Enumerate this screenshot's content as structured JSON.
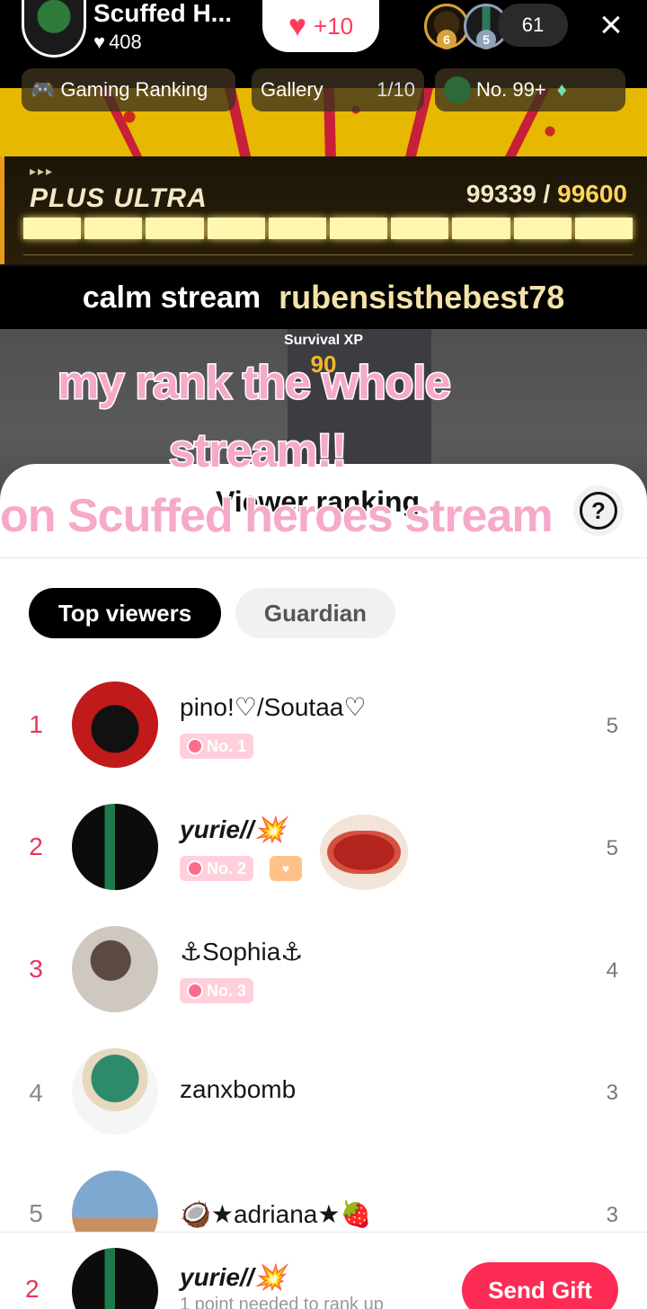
{
  "header": {
    "host_name": "Scuffed H...",
    "likes": "408",
    "like_pill": "+10",
    "viewer_badges": [
      "6",
      "5"
    ],
    "viewer_count": "61",
    "close_icon": "×"
  },
  "chips": {
    "gaming_ranking": "Gaming Ranking",
    "gallery": "Gallery",
    "gallery_count": "1/10",
    "rank": "No. 99+"
  },
  "goal": {
    "dots": "▸▸▸",
    "title": "PLUS ULTRA",
    "current": "99339",
    "separator": " / ",
    "target": "99600",
    "segments": 10
  },
  "banner": {
    "label": "calm stream",
    "user": "rubensisthebest78"
  },
  "survival": {
    "label": "Survival XP",
    "value": "90"
  },
  "caption": {
    "line1": "my rank the whole",
    "line2": "stream!!",
    "line3": "on Scuffed heroes stream"
  },
  "sheet": {
    "title": "Viewer ranking",
    "help": "?",
    "tabs": [
      "Top viewers",
      "Guardian"
    ]
  },
  "rows": [
    {
      "rank": "1",
      "name": "pino!♡/Soutaa♡",
      "badge": "No. 1",
      "score": "5"
    },
    {
      "rank": "2",
      "name": "yurie//💥",
      "badge": "No. 2",
      "score": "5"
    },
    {
      "rank": "3",
      "name": "⚓Sophia⚓",
      "badge": "No. 3",
      "score": "4"
    },
    {
      "rank": "4",
      "name": "zanxbomb",
      "badge": "",
      "score": "3"
    },
    {
      "rank": "5",
      "name": "🥥★adriana★🍓",
      "badge": "",
      "score": "3"
    }
  ],
  "me": {
    "rank": "2",
    "name": "yurie//💥",
    "sub": "1 point needed to rank up",
    "send_gift": "Send Gift"
  },
  "colors": {
    "accent": "#fe2c55",
    "rank_top": "#e8355a",
    "badge_pink": "#ffd0dc",
    "goal_bar": "#fff6b0"
  }
}
